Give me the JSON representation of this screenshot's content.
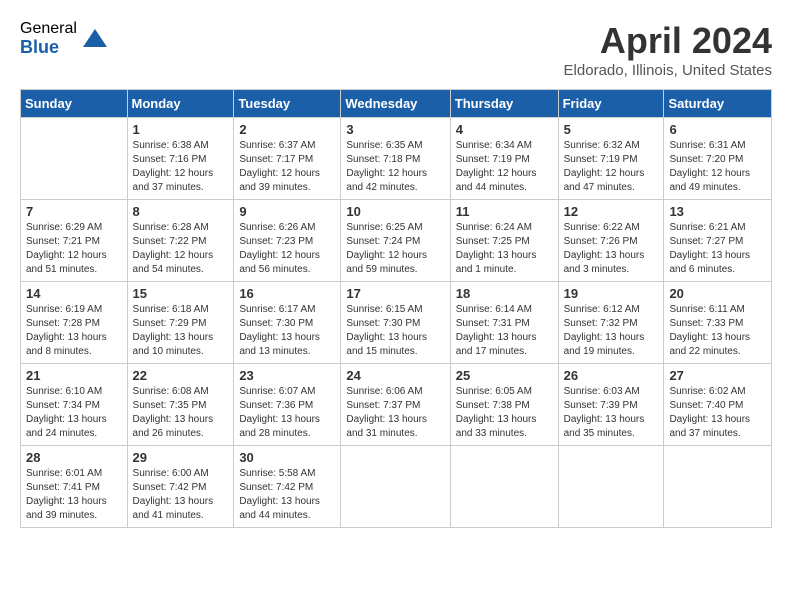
{
  "logo": {
    "general": "General",
    "blue": "Blue"
  },
  "title": "April 2024",
  "location": "Eldorado, Illinois, United States",
  "days": [
    "Sunday",
    "Monday",
    "Tuesday",
    "Wednesday",
    "Thursday",
    "Friday",
    "Saturday"
  ],
  "weeks": [
    [
      {
        "date": "",
        "sunrise": "",
        "sunset": "",
        "daylight": ""
      },
      {
        "date": "1",
        "sunrise": "Sunrise: 6:38 AM",
        "sunset": "Sunset: 7:16 PM",
        "daylight": "Daylight: 12 hours and 37 minutes."
      },
      {
        "date": "2",
        "sunrise": "Sunrise: 6:37 AM",
        "sunset": "Sunset: 7:17 PM",
        "daylight": "Daylight: 12 hours and 39 minutes."
      },
      {
        "date": "3",
        "sunrise": "Sunrise: 6:35 AM",
        "sunset": "Sunset: 7:18 PM",
        "daylight": "Daylight: 12 hours and 42 minutes."
      },
      {
        "date": "4",
        "sunrise": "Sunrise: 6:34 AM",
        "sunset": "Sunset: 7:19 PM",
        "daylight": "Daylight: 12 hours and 44 minutes."
      },
      {
        "date": "5",
        "sunrise": "Sunrise: 6:32 AM",
        "sunset": "Sunset: 7:19 PM",
        "daylight": "Daylight: 12 hours and 47 minutes."
      },
      {
        "date": "6",
        "sunrise": "Sunrise: 6:31 AM",
        "sunset": "Sunset: 7:20 PM",
        "daylight": "Daylight: 12 hours and 49 minutes."
      }
    ],
    [
      {
        "date": "7",
        "sunrise": "Sunrise: 6:29 AM",
        "sunset": "Sunset: 7:21 PM",
        "daylight": "Daylight: 12 hours and 51 minutes."
      },
      {
        "date": "8",
        "sunrise": "Sunrise: 6:28 AM",
        "sunset": "Sunset: 7:22 PM",
        "daylight": "Daylight: 12 hours and 54 minutes."
      },
      {
        "date": "9",
        "sunrise": "Sunrise: 6:26 AM",
        "sunset": "Sunset: 7:23 PM",
        "daylight": "Daylight: 12 hours and 56 minutes."
      },
      {
        "date": "10",
        "sunrise": "Sunrise: 6:25 AM",
        "sunset": "Sunset: 7:24 PM",
        "daylight": "Daylight: 12 hours and 59 minutes."
      },
      {
        "date": "11",
        "sunrise": "Sunrise: 6:24 AM",
        "sunset": "Sunset: 7:25 PM",
        "daylight": "Daylight: 13 hours and 1 minute."
      },
      {
        "date": "12",
        "sunrise": "Sunrise: 6:22 AM",
        "sunset": "Sunset: 7:26 PM",
        "daylight": "Daylight: 13 hours and 3 minutes."
      },
      {
        "date": "13",
        "sunrise": "Sunrise: 6:21 AM",
        "sunset": "Sunset: 7:27 PM",
        "daylight": "Daylight: 13 hours and 6 minutes."
      }
    ],
    [
      {
        "date": "14",
        "sunrise": "Sunrise: 6:19 AM",
        "sunset": "Sunset: 7:28 PM",
        "daylight": "Daylight: 13 hours and 8 minutes."
      },
      {
        "date": "15",
        "sunrise": "Sunrise: 6:18 AM",
        "sunset": "Sunset: 7:29 PM",
        "daylight": "Daylight: 13 hours and 10 minutes."
      },
      {
        "date": "16",
        "sunrise": "Sunrise: 6:17 AM",
        "sunset": "Sunset: 7:30 PM",
        "daylight": "Daylight: 13 hours and 13 minutes."
      },
      {
        "date": "17",
        "sunrise": "Sunrise: 6:15 AM",
        "sunset": "Sunset: 7:30 PM",
        "daylight": "Daylight: 13 hours and 15 minutes."
      },
      {
        "date": "18",
        "sunrise": "Sunrise: 6:14 AM",
        "sunset": "Sunset: 7:31 PM",
        "daylight": "Daylight: 13 hours and 17 minutes."
      },
      {
        "date": "19",
        "sunrise": "Sunrise: 6:12 AM",
        "sunset": "Sunset: 7:32 PM",
        "daylight": "Daylight: 13 hours and 19 minutes."
      },
      {
        "date": "20",
        "sunrise": "Sunrise: 6:11 AM",
        "sunset": "Sunset: 7:33 PM",
        "daylight": "Daylight: 13 hours and 22 minutes."
      }
    ],
    [
      {
        "date": "21",
        "sunrise": "Sunrise: 6:10 AM",
        "sunset": "Sunset: 7:34 PM",
        "daylight": "Daylight: 13 hours and 24 minutes."
      },
      {
        "date": "22",
        "sunrise": "Sunrise: 6:08 AM",
        "sunset": "Sunset: 7:35 PM",
        "daylight": "Daylight: 13 hours and 26 minutes."
      },
      {
        "date": "23",
        "sunrise": "Sunrise: 6:07 AM",
        "sunset": "Sunset: 7:36 PM",
        "daylight": "Daylight: 13 hours and 28 minutes."
      },
      {
        "date": "24",
        "sunrise": "Sunrise: 6:06 AM",
        "sunset": "Sunset: 7:37 PM",
        "daylight": "Daylight: 13 hours and 31 minutes."
      },
      {
        "date": "25",
        "sunrise": "Sunrise: 6:05 AM",
        "sunset": "Sunset: 7:38 PM",
        "daylight": "Daylight: 13 hours and 33 minutes."
      },
      {
        "date": "26",
        "sunrise": "Sunrise: 6:03 AM",
        "sunset": "Sunset: 7:39 PM",
        "daylight": "Daylight: 13 hours and 35 minutes."
      },
      {
        "date": "27",
        "sunrise": "Sunrise: 6:02 AM",
        "sunset": "Sunset: 7:40 PM",
        "daylight": "Daylight: 13 hours and 37 minutes."
      }
    ],
    [
      {
        "date": "28",
        "sunrise": "Sunrise: 6:01 AM",
        "sunset": "Sunset: 7:41 PM",
        "daylight": "Daylight: 13 hours and 39 minutes."
      },
      {
        "date": "29",
        "sunrise": "Sunrise: 6:00 AM",
        "sunset": "Sunset: 7:42 PM",
        "daylight": "Daylight: 13 hours and 41 minutes."
      },
      {
        "date": "30",
        "sunrise": "Sunrise: 5:58 AM",
        "sunset": "Sunset: 7:42 PM",
        "daylight": "Daylight: 13 hours and 44 minutes."
      },
      {
        "date": "",
        "sunrise": "",
        "sunset": "",
        "daylight": ""
      },
      {
        "date": "",
        "sunrise": "",
        "sunset": "",
        "daylight": ""
      },
      {
        "date": "",
        "sunrise": "",
        "sunset": "",
        "daylight": ""
      },
      {
        "date": "",
        "sunrise": "",
        "sunset": "",
        "daylight": ""
      }
    ]
  ]
}
